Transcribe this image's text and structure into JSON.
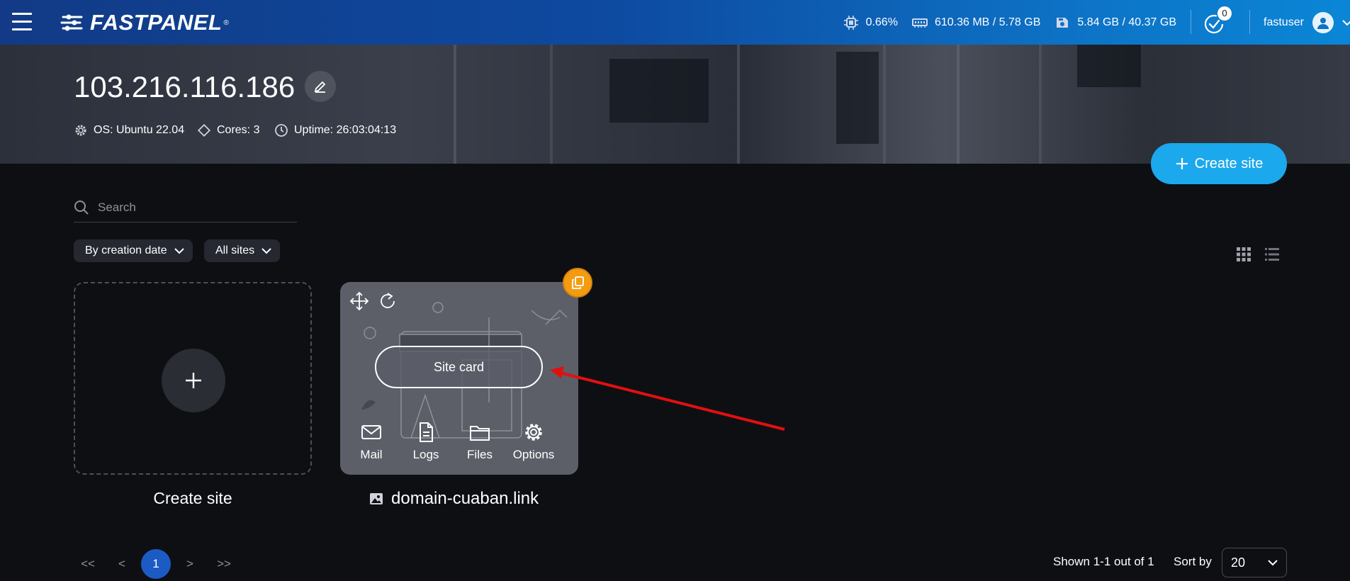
{
  "topbar": {
    "brand": "FASTPANEL",
    "brand_mark": "®",
    "cpu": "0.66%",
    "ram": "610.36 MB / 5.78 GB",
    "disk": "5.84 GB / 40.37 GB",
    "notifications": "0",
    "username": "fastuser"
  },
  "server": {
    "ip": "103.216.116.186",
    "os": "OS: Ubuntu 22.04",
    "cores": "Cores: 3",
    "uptime": "Uptime: 26:03:04:13"
  },
  "actions": {
    "create_site": "Create site"
  },
  "search": {
    "placeholder": "Search"
  },
  "filters": {
    "sort": "By creation date",
    "scope": "All sites"
  },
  "cards": {
    "create_caption": "Create site",
    "site_card_label": "Site card",
    "site_name": "domain-cuaban.link",
    "actions": [
      "Mail",
      "Logs",
      "Files",
      "Options"
    ]
  },
  "pagination": {
    "first": "<<",
    "prev": "<",
    "current": "1",
    "next": ">",
    "last": ">>",
    "shown": "Shown 1-1 out of 1",
    "sort_label": "Sort by",
    "page_size": "20"
  },
  "colors": {
    "accent": "#1ba8ec",
    "badge": "#f39c12",
    "annotation_arrow": "#e01010"
  }
}
